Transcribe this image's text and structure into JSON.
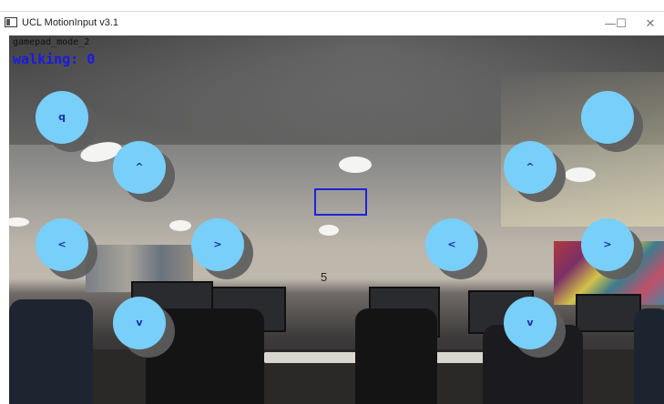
{
  "window": {
    "title": "UCL MotionInput v3.1",
    "minimize_glyph": "—",
    "maximize_glyph": "☐",
    "close_glyph": "✕"
  },
  "overlay": {
    "mode_label": "gamepad_mode_2",
    "walking_label": "walking: 0",
    "counter": "5",
    "accent_text_color": "#1a1ae6",
    "pad_color": "#78cff9",
    "rect_color": "#1c24d8"
  },
  "pads": {
    "left_top": "q",
    "left_up": "^",
    "left_left": "<",
    "left_right": ">",
    "left_down": "v",
    "right_top": "",
    "right_up": "^",
    "right_left": "<",
    "right_right": ">",
    "right_down": "v"
  }
}
